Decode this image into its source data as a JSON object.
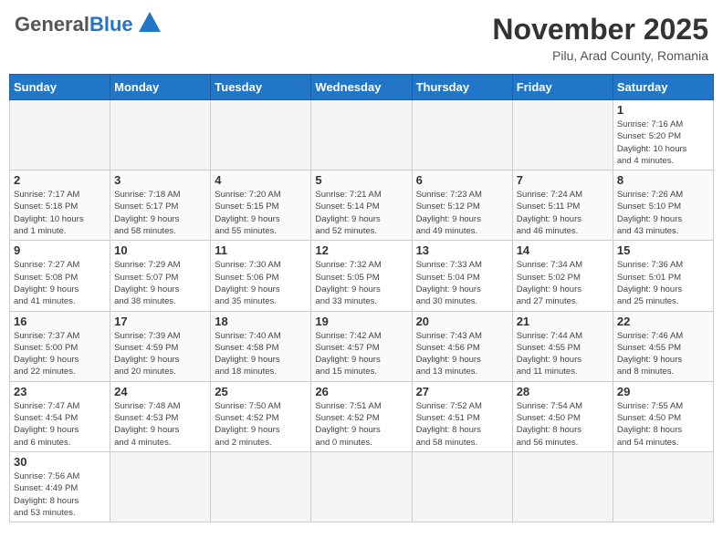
{
  "header": {
    "logo_general": "General",
    "logo_blue": "Blue",
    "month_title": "November 2025",
    "subtitle": "Pilu, Arad County, Romania"
  },
  "weekdays": [
    "Sunday",
    "Monday",
    "Tuesday",
    "Wednesday",
    "Thursday",
    "Friday",
    "Saturday"
  ],
  "weeks": [
    [
      {
        "day": null,
        "info": null
      },
      {
        "day": null,
        "info": null
      },
      {
        "day": null,
        "info": null
      },
      {
        "day": null,
        "info": null
      },
      {
        "day": null,
        "info": null
      },
      {
        "day": null,
        "info": null
      },
      {
        "day": "1",
        "info": "Sunrise: 7:16 AM\nSunset: 5:20 PM\nDaylight: 10 hours\nand 4 minutes."
      }
    ],
    [
      {
        "day": "2",
        "info": "Sunrise: 7:17 AM\nSunset: 5:18 PM\nDaylight: 10 hours\nand 1 minute."
      },
      {
        "day": "3",
        "info": "Sunrise: 7:18 AM\nSunset: 5:17 PM\nDaylight: 9 hours\nand 58 minutes."
      },
      {
        "day": "4",
        "info": "Sunrise: 7:20 AM\nSunset: 5:15 PM\nDaylight: 9 hours\nand 55 minutes."
      },
      {
        "day": "5",
        "info": "Sunrise: 7:21 AM\nSunset: 5:14 PM\nDaylight: 9 hours\nand 52 minutes."
      },
      {
        "day": "6",
        "info": "Sunrise: 7:23 AM\nSunset: 5:12 PM\nDaylight: 9 hours\nand 49 minutes."
      },
      {
        "day": "7",
        "info": "Sunrise: 7:24 AM\nSunset: 5:11 PM\nDaylight: 9 hours\nand 46 minutes."
      },
      {
        "day": "8",
        "info": "Sunrise: 7:26 AM\nSunset: 5:10 PM\nDaylight: 9 hours\nand 43 minutes."
      }
    ],
    [
      {
        "day": "9",
        "info": "Sunrise: 7:27 AM\nSunset: 5:08 PM\nDaylight: 9 hours\nand 41 minutes."
      },
      {
        "day": "10",
        "info": "Sunrise: 7:29 AM\nSunset: 5:07 PM\nDaylight: 9 hours\nand 38 minutes."
      },
      {
        "day": "11",
        "info": "Sunrise: 7:30 AM\nSunset: 5:06 PM\nDaylight: 9 hours\nand 35 minutes."
      },
      {
        "day": "12",
        "info": "Sunrise: 7:32 AM\nSunset: 5:05 PM\nDaylight: 9 hours\nand 33 minutes."
      },
      {
        "day": "13",
        "info": "Sunrise: 7:33 AM\nSunset: 5:04 PM\nDaylight: 9 hours\nand 30 minutes."
      },
      {
        "day": "14",
        "info": "Sunrise: 7:34 AM\nSunset: 5:02 PM\nDaylight: 9 hours\nand 27 minutes."
      },
      {
        "day": "15",
        "info": "Sunrise: 7:36 AM\nSunset: 5:01 PM\nDaylight: 9 hours\nand 25 minutes."
      }
    ],
    [
      {
        "day": "16",
        "info": "Sunrise: 7:37 AM\nSunset: 5:00 PM\nDaylight: 9 hours\nand 22 minutes."
      },
      {
        "day": "17",
        "info": "Sunrise: 7:39 AM\nSunset: 4:59 PM\nDaylight: 9 hours\nand 20 minutes."
      },
      {
        "day": "18",
        "info": "Sunrise: 7:40 AM\nSunset: 4:58 PM\nDaylight: 9 hours\nand 18 minutes."
      },
      {
        "day": "19",
        "info": "Sunrise: 7:42 AM\nSunset: 4:57 PM\nDaylight: 9 hours\nand 15 minutes."
      },
      {
        "day": "20",
        "info": "Sunrise: 7:43 AM\nSunset: 4:56 PM\nDaylight: 9 hours\nand 13 minutes."
      },
      {
        "day": "21",
        "info": "Sunrise: 7:44 AM\nSunset: 4:55 PM\nDaylight: 9 hours\nand 11 minutes."
      },
      {
        "day": "22",
        "info": "Sunrise: 7:46 AM\nSunset: 4:55 PM\nDaylight: 9 hours\nand 8 minutes."
      }
    ],
    [
      {
        "day": "23",
        "info": "Sunrise: 7:47 AM\nSunset: 4:54 PM\nDaylight: 9 hours\nand 6 minutes."
      },
      {
        "day": "24",
        "info": "Sunrise: 7:48 AM\nSunset: 4:53 PM\nDaylight: 9 hours\nand 4 minutes."
      },
      {
        "day": "25",
        "info": "Sunrise: 7:50 AM\nSunset: 4:52 PM\nDaylight: 9 hours\nand 2 minutes."
      },
      {
        "day": "26",
        "info": "Sunrise: 7:51 AM\nSunset: 4:52 PM\nDaylight: 9 hours\nand 0 minutes."
      },
      {
        "day": "27",
        "info": "Sunrise: 7:52 AM\nSunset: 4:51 PM\nDaylight: 8 hours\nand 58 minutes."
      },
      {
        "day": "28",
        "info": "Sunrise: 7:54 AM\nSunset: 4:50 PM\nDaylight: 8 hours\nand 56 minutes."
      },
      {
        "day": "29",
        "info": "Sunrise: 7:55 AM\nSunset: 4:50 PM\nDaylight: 8 hours\nand 54 minutes."
      }
    ],
    [
      {
        "day": "30",
        "info": "Sunrise: 7:56 AM\nSunset: 4:49 PM\nDaylight: 8 hours\nand 53 minutes."
      },
      {
        "day": null,
        "info": null
      },
      {
        "day": null,
        "info": null
      },
      {
        "day": null,
        "info": null
      },
      {
        "day": null,
        "info": null
      },
      {
        "day": null,
        "info": null
      },
      {
        "day": null,
        "info": null
      }
    ]
  ]
}
